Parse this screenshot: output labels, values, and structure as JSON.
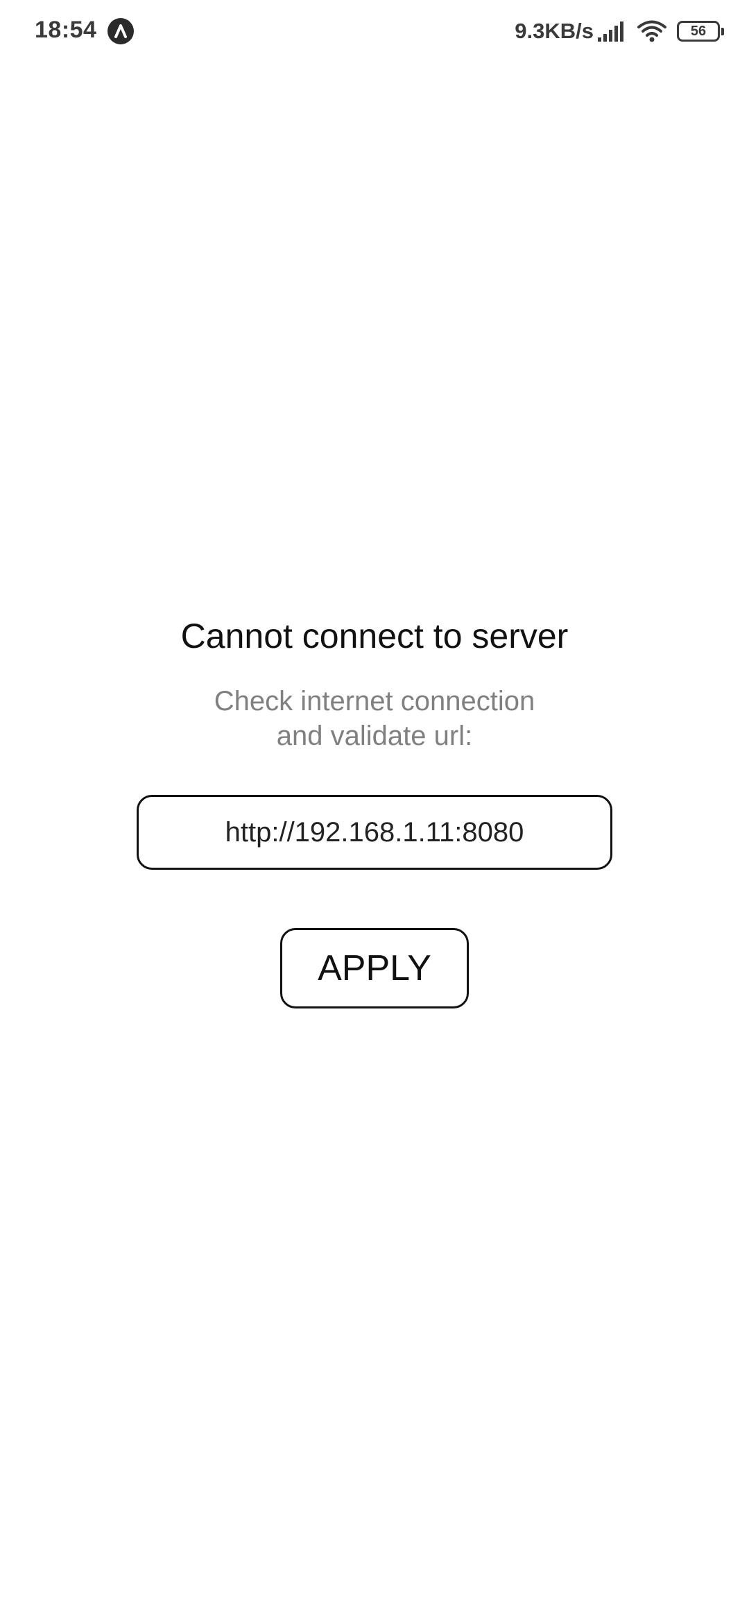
{
  "status_bar": {
    "time": "18:54",
    "app_icon": "navigation-arrow-icon",
    "net_speed": "9.3KB/s",
    "signal_icon": "cellular-signal-icon",
    "wifi_icon": "wifi-icon",
    "battery_level": "56"
  },
  "main": {
    "title": "Cannot connect to server",
    "subtitle_line1": "Check internet connection",
    "subtitle_line2": "and validate url:",
    "url_value": "http://192.168.1.11:8080",
    "apply_label": "APPLY"
  },
  "colors": {
    "text_primary": "#111111",
    "text_secondary": "#808080",
    "border": "#111111",
    "background": "#ffffff"
  }
}
